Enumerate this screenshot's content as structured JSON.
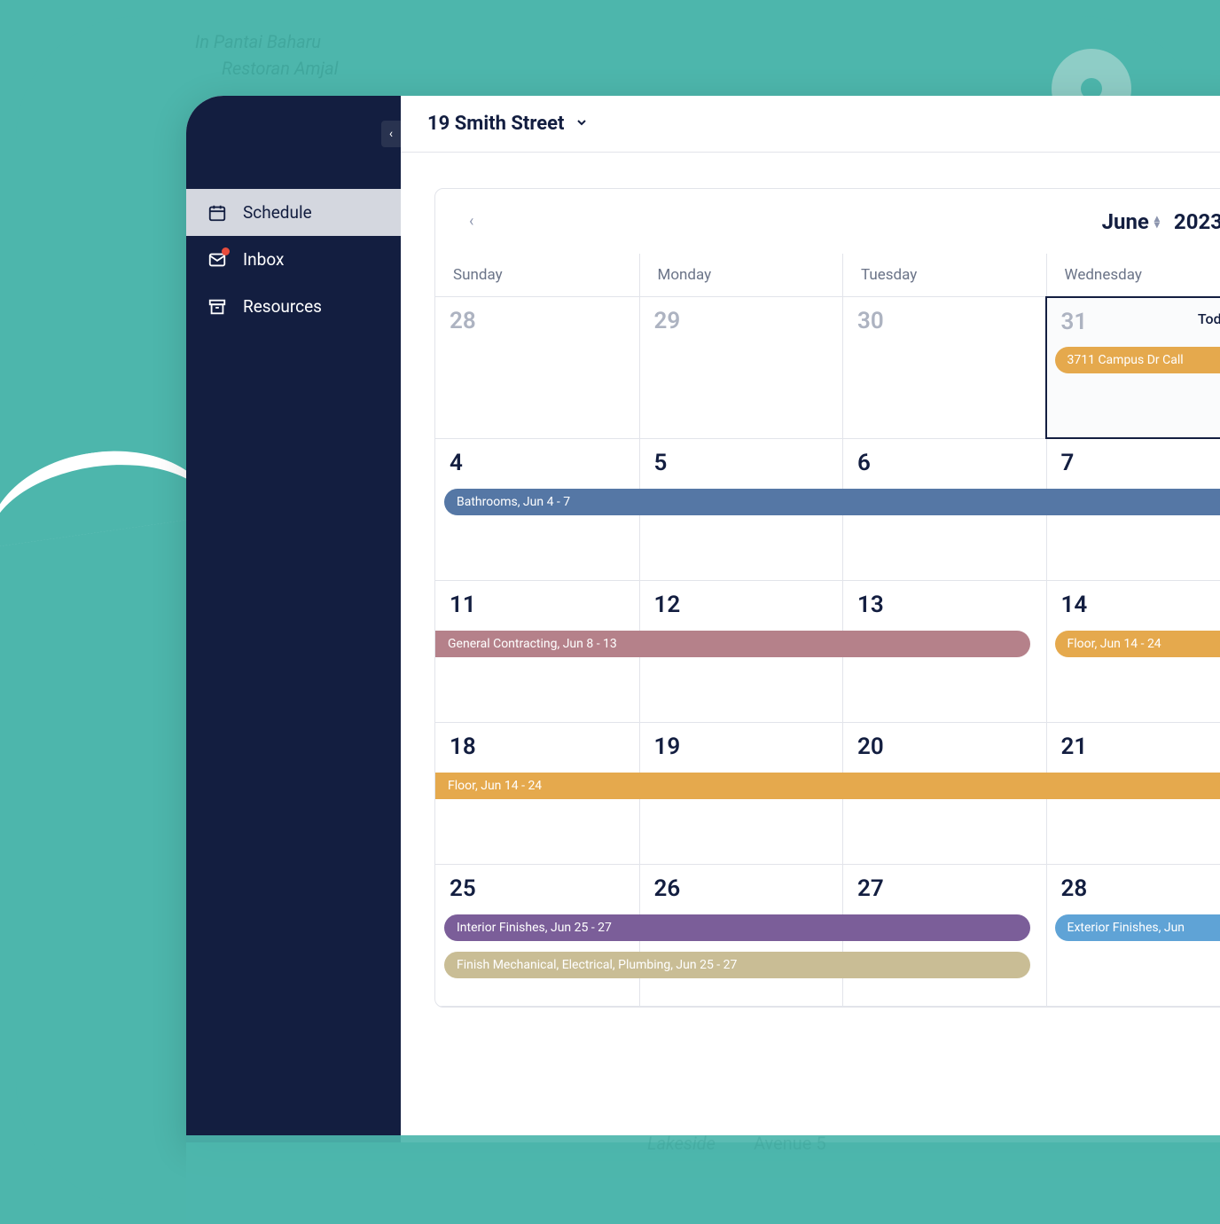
{
  "map": {
    "text1": "In Pantai Baharu",
    "text2": "Restoran Amjal",
    "text3": "Lakeside",
    "text4": "Avenue 5"
  },
  "sidebar": {
    "items": [
      {
        "label": "Schedule",
        "active": true
      },
      {
        "label": "Inbox",
        "active": false
      },
      {
        "label": "Resources",
        "active": false
      }
    ]
  },
  "header": {
    "property": "19 Smith Street"
  },
  "calendar": {
    "month": "June",
    "year": "2023",
    "today_label": "Today",
    "day_headers": [
      "Sunday",
      "Monday",
      "Tuesday",
      "Wednesday"
    ],
    "weeks": [
      {
        "days": [
          "28",
          "29",
          "30",
          "31"
        ],
        "muted": [
          true,
          true,
          true,
          true
        ],
        "today_index": 3
      },
      {
        "days": [
          "4",
          "5",
          "6",
          "7"
        ]
      },
      {
        "days": [
          "11",
          "12",
          "13",
          "14"
        ]
      },
      {
        "days": [
          "18",
          "19",
          "20",
          "21"
        ]
      },
      {
        "days": [
          "25",
          "26",
          "27",
          "28"
        ]
      }
    ],
    "events": {
      "campus": "3711 Campus Dr Call",
      "bathrooms": "Bathrooms, Jun 4 - 7",
      "general": "General Contracting, Jun 8 - 13",
      "floor1": "Floor, Jun 14 - 24",
      "floor2": "Floor, Jun 14 - 24",
      "interior": "Interior Finishes, Jun 25 - 27",
      "exterior": "Exterior Finishes, Jun",
      "finish": "Finish Mechanical, Electrical, Plumbing, Jun 25 - 27"
    }
  },
  "colors": {
    "sidebar_bg": "#131e40",
    "teal": "#4db6ac",
    "event_orange": "#e5a94d",
    "event_blue": "#5577a5",
    "event_mauve": "#b5818a",
    "event_purple": "#7b5e99",
    "event_tan": "#c9bd95",
    "event_sky": "#5fa3d6"
  }
}
